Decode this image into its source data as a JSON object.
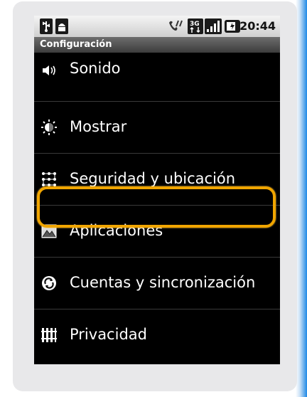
{
  "statusbar": {
    "time": "20:44",
    "left_icons": [
      "usb-icon",
      "android-debug-icon"
    ],
    "right_icons": [
      "phone-no-signal-icon",
      "3g-data-icon",
      "signal-bars-icon",
      "battery-icon"
    ]
  },
  "titlebar": {
    "title": "Configuración"
  },
  "menu": {
    "items": [
      {
        "label": "Sonido",
        "icon": "speaker-icon"
      },
      {
        "label": "Mostrar",
        "icon": "brightness-icon"
      },
      {
        "label": "Seguridad y ubicación",
        "icon": "grid-lock-icon",
        "highlighted": true
      },
      {
        "label": "Aplicaciones",
        "icon": "applications-icon"
      },
      {
        "label": "Cuentas y sincronización",
        "icon": "sync-icon"
      },
      {
        "label": "Privacidad",
        "icon": "privacy-icon"
      }
    ]
  },
  "colors": {
    "highlight": "#f0a500",
    "background": "#000000",
    "text": "#ffffff",
    "accent_edge": "#1e88e5"
  }
}
